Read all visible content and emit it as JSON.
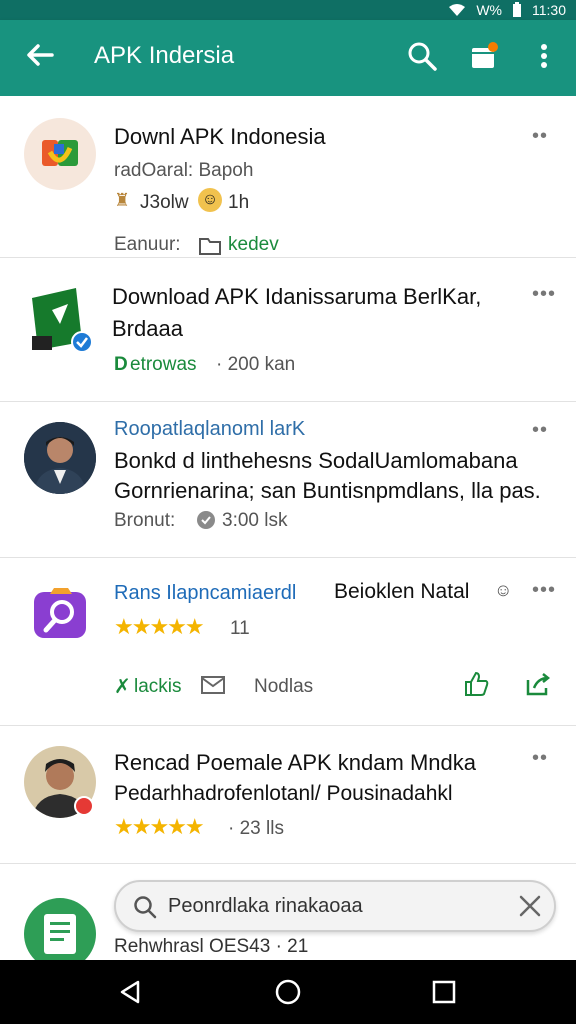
{
  "status": {
    "battery_text": "W%",
    "time": "11:30"
  },
  "app_bar": {
    "title": "APK Indersia"
  },
  "posts": [
    {
      "title": "Downl APK Indonesia",
      "subtitle": "radOaral: Bapoh",
      "meta_text": "J3olw",
      "meta_time": "1h",
      "footer_left": "Eanuur:",
      "footer_link": "kedev"
    },
    {
      "title_line1": "Download APK Idanissaruma BerlKar,",
      "title_line2": "Brdaaa",
      "badge": "D",
      "source": "etrowas",
      "meta": "· 200 kan"
    },
    {
      "author": "Roopatlaqlanoml larK",
      "line1": "Bonkd d linthehesns SodalUamlomabana",
      "line2": "Gornrienarina; san Buntisnpmdlans, lla pas.",
      "footer_left": "Bronut:",
      "time": "3:00 lsk"
    },
    {
      "title_blue": "Rans Ilapncamiaerdl",
      "title_rest": "Beioklen Natal",
      "rating_text": "11",
      "action_left": "lackis",
      "action_mid": "Nodlas",
      "rating": 4.5
    },
    {
      "title": "Rencad Poemale APK  kndam Mndka",
      "subtitle": "Pedarhhadrofenlotanl/ Pousinadahkl",
      "rating_text": "· 23 lls",
      "rating": 4.5
    },
    {
      "footer": "Rehwhrasl OES43 · 21"
    }
  ],
  "search": {
    "placeholder": "Peonrdlaka rinakaoaa"
  },
  "colors": {
    "app_bar": "#18937f",
    "green": "#1a8a3c",
    "blue": "#1e6bb8",
    "star": "#f4b400"
  }
}
